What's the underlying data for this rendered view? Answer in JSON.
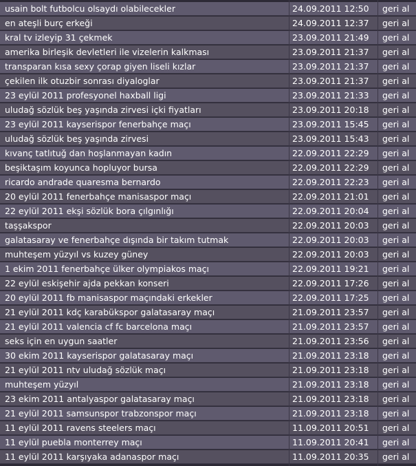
{
  "entries": [
    {
      "title": "usain bolt futbolcu olsaydı olabilecekler",
      "date": "24.09.2011 12:50",
      "action": "geri al"
    },
    {
      "title": "en ateşli burç erkeği",
      "date": "24.09.2011 12:37",
      "action": "geri al"
    },
    {
      "title": "kral tv izleyip 31 çekmek",
      "date": "23.09.2011 21:49",
      "action": "geri al"
    },
    {
      "title": "amerika birleşik devletleri ile vizelerin kalkması",
      "date": "23.09.2011 21:37",
      "action": "geri al"
    },
    {
      "title": "transparan kısa sexy çorap giyen liseli kızlar",
      "date": "23.09.2011 21:37",
      "action": "geri al"
    },
    {
      "title": "çekilen ilk otuzbir sonrası diyaloglar",
      "date": "23.09.2011 21:37",
      "action": "geri al"
    },
    {
      "title": "23 eylül 2011 profesyonel haxball ligi",
      "date": "23.09.2011 21:33",
      "action": "geri al"
    },
    {
      "title": "uludağ sözlük beş yaşında zirvesi içki fiyatları",
      "date": "23.09.2011 20:18",
      "action": "geri al"
    },
    {
      "title": "23 eylül 2011 kayserispor fenerbahçe maçı",
      "date": "23.09.2011 15:45",
      "action": "geri al"
    },
    {
      "title": "uludağ sözlük beş yaşında zirvesi",
      "date": "23.09.2011 15:43",
      "action": "geri al"
    },
    {
      "title": "kıvanç tatlıtuğ dan hoşlanmayan kadın",
      "date": "22.09.2011 22:29",
      "action": "geri al"
    },
    {
      "title": "beşiktaşım koyunca hopluyor bursa",
      "date": "22.09.2011 22:29",
      "action": "geri al"
    },
    {
      "title": "ricardo andrade quaresma bernardo",
      "date": "22.09.2011 22:23",
      "action": "geri al"
    },
    {
      "title": "20 eylül 2011 fenerbahçe manisaspor maçı",
      "date": "22.09.2011 21:01",
      "action": "geri al"
    },
    {
      "title": "22 eylül 2011 ekşi sözlük bora çılgınlığı",
      "date": "22.09.2011 20:04",
      "action": "geri al"
    },
    {
      "title": "taşşakspor",
      "date": "22.09.2011 20:03",
      "action": "geri al"
    },
    {
      "title": "galatasaray ve fenerbahçe dışında bir takım tutmak",
      "date": "22.09.2011 20:03",
      "action": "geri al"
    },
    {
      "title": "muhteşem yüzyıl vs kuzey güney",
      "date": "22.09.2011 20:03",
      "action": "geri al"
    },
    {
      "title": "1 ekim 2011 fenerbahçe ülker olympiakos maçı",
      "date": "22.09.2011 19:21",
      "action": "geri al"
    },
    {
      "title": "22 eylül eskişehir ajda pekkan konseri",
      "date": "22.09.2011 17:26",
      "action": "geri al"
    },
    {
      "title": "20 eylül 2011 fb manisaspor maçındaki erkekler",
      "date": "22.09.2011 17:25",
      "action": "geri al"
    },
    {
      "title": "21 eylül 2011 kdç karabükspor galatasaray maçı",
      "date": "21.09.2011 23:57",
      "action": "geri al"
    },
    {
      "title": "21 eylül 2011 valencia cf fc barcelona maçı",
      "date": "21.09.2011 23:57",
      "action": "geri al"
    },
    {
      "title": "seks için en uygun saatler",
      "date": "21.09.2011 23:56",
      "action": "geri al"
    },
    {
      "title": "30 ekim 2011 kayserispor galatasaray maçı",
      "date": "21.09.2011 23:18",
      "action": "geri al"
    },
    {
      "title": "21 eylül 2011 ntv uludağ sözlük maçı",
      "date": "21.09.2011 23:18",
      "action": "geri al"
    },
    {
      "title": "muhteşem yüzyıl",
      "date": "21.09.2011 23:18",
      "action": "geri al"
    },
    {
      "title": "23 ekim 2011 antalyaspor galatasaray maçı",
      "date": "21.09.2011 23:18",
      "action": "geri al"
    },
    {
      "title": "21 eylül 2011 samsunspor trabzonspor maçı",
      "date": "21.09.2011 23:18",
      "action": "geri al"
    },
    {
      "title": "11 eylül 2011 ravens steelers maçı",
      "date": "11.09.2011 20:51",
      "action": "geri al"
    },
    {
      "title": "11 eylül puebla monterrey maçı",
      "date": "11.09.2011 20:41",
      "action": "geri al"
    },
    {
      "title": "11 eylül 2011 karşıyaka adanaspor maçı",
      "date": "11.09.2011 20:35",
      "action": "geri al"
    }
  ]
}
